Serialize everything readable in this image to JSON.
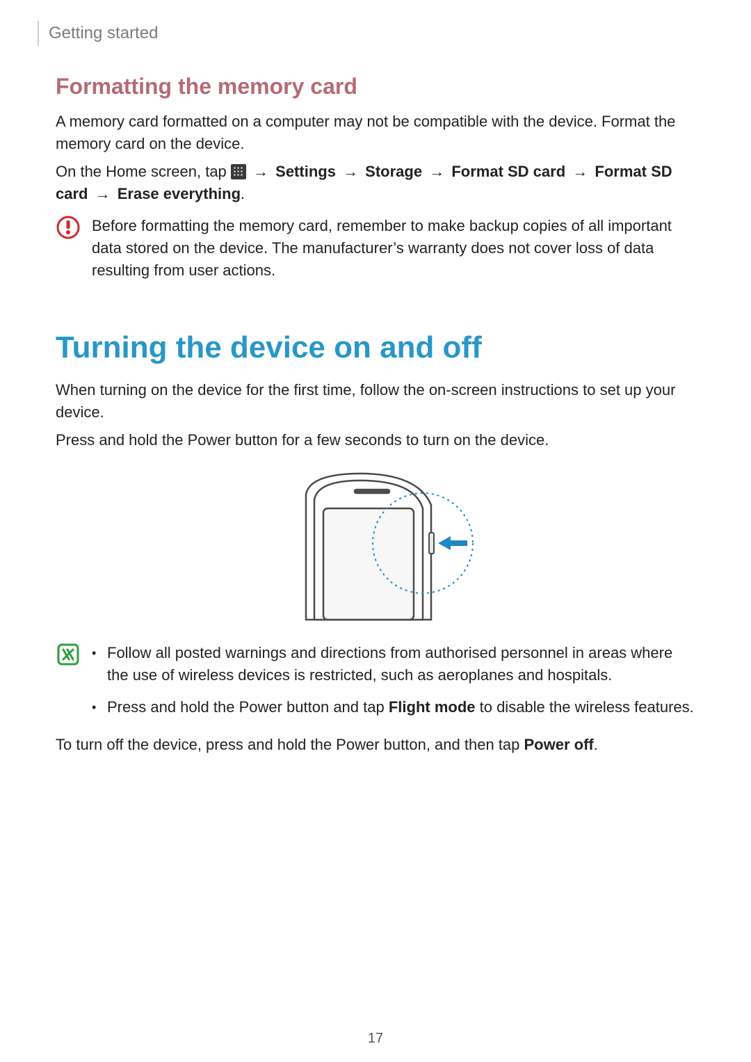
{
  "header": {
    "section": "Getting started"
  },
  "formatting": {
    "heading": "Formatting the memory card",
    "p1": "A memory card formatted on a computer may not be compatible with the device. Format the memory card on the device.",
    "nav_intro": "On the Home screen, tap ",
    "arrow": " → ",
    "nav1": "Settings",
    "nav2": "Storage",
    "nav3": "Format SD card",
    "nav4": "Format SD card",
    "nav5": "Erase everything",
    "nav_period": ".",
    "caution_icon": "caution-icon",
    "caution_text": "Before formatting the memory card, remember to make backup copies of all important data stored on the device. The manufacturer’s warranty does not cover loss of data resulting from user actions."
  },
  "turning": {
    "heading": "Turning the device on and off",
    "p1": "When turning on the device for the first time, follow the on-screen instructions to set up your device.",
    "p2": "Press and hold the Power button for a few seconds to turn on the device.",
    "note_icon": "note-icon",
    "b1_a": "Follow all posted warnings and directions from authorised personnel in areas where the use of wireless devices is restricted, such as aeroplanes and hospitals.",
    "b2_a": "Press and hold the Power button and tap ",
    "b2_bold": "Flight mode",
    "b2_b": " to disable the wireless features.",
    "p3_a": "To turn off the device, press and hold the Power button, and then tap ",
    "p3_bold": "Power off",
    "p3_b": "."
  },
  "page_number": "17"
}
